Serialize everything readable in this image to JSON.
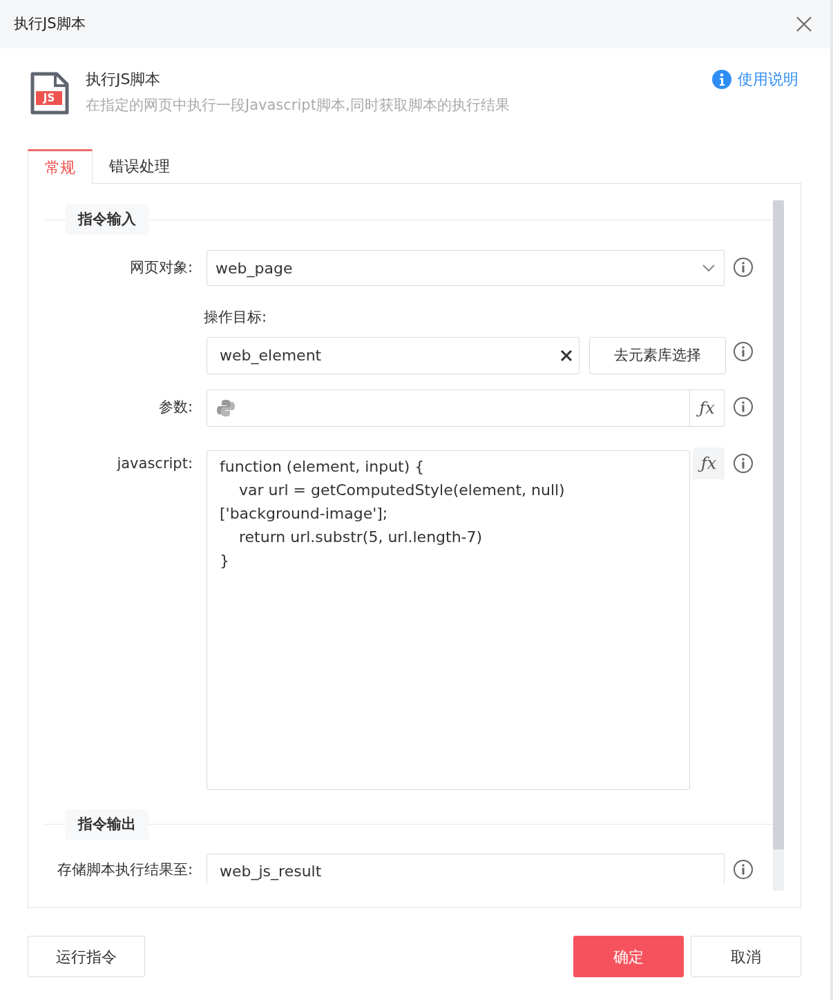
{
  "dialog": {
    "title": "执行JS脚本"
  },
  "header": {
    "icon_text": "JS",
    "title": "执行JS脚本",
    "description": "在指定的网页中执行一段Javascript脚本,同时获取脚本的执行结果",
    "help_link": "使用说明"
  },
  "tabs": [
    {
      "label": "常规",
      "selected": true
    },
    {
      "label": "错误处理",
      "selected": false
    }
  ],
  "sections": [
    {
      "title": "指令输入",
      "fields": [
        {
          "kind": "select",
          "label": "网页对象:",
          "value": "web_page"
        },
        {
          "kind": "target",
          "label": "操作目标:",
          "value": "web_element",
          "button": "去元素库选择"
        },
        {
          "kind": "param",
          "label": "参数:",
          "formula_button": "ƒx"
        },
        {
          "kind": "code",
          "label": "javascript:",
          "formula_button": "ƒx",
          "lines": [
            "function (element, input) {",
            "    var url = getComputedStyle(element, null)",
            "['background-image'];",
            "    return url.substr(5, url.length-7)",
            "}"
          ]
        }
      ]
    },
    {
      "title": "指令输出",
      "fields": [
        {
          "kind": "text",
          "label": "存储脚本执行结果至:",
          "value": "web_js_result"
        }
      ]
    }
  ],
  "footer": {
    "run_button": "运行指令",
    "ok_button": "确定",
    "cancel_button": "取消"
  }
}
